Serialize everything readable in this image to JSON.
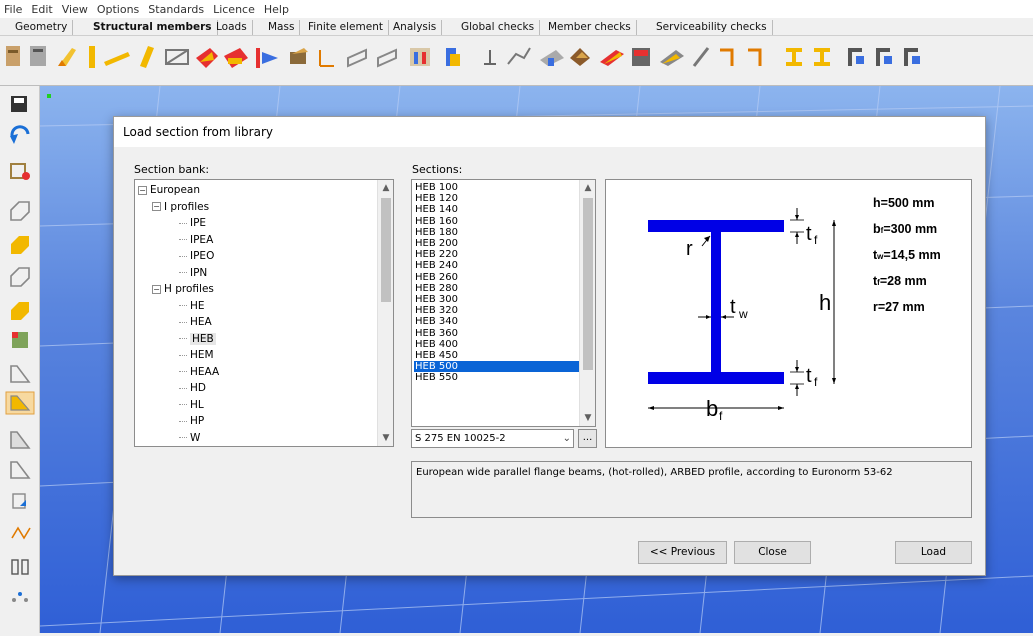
{
  "menu": [
    "File",
    "Edit",
    "View",
    "Options",
    "Standards",
    "Licence",
    "Help"
  ],
  "tabs": [
    {
      "label": "Geometry",
      "active": false
    },
    {
      "label": "Structural members",
      "active": true
    },
    {
      "label": "Loads",
      "active": false
    },
    {
      "label": "Mass",
      "active": false
    },
    {
      "label": "Finite element",
      "active": false
    },
    {
      "label": "Analysis",
      "active": false
    },
    {
      "label": "Global checks",
      "active": false
    },
    {
      "label": "Member checks",
      "active": false
    },
    {
      "label": "Serviceability checks",
      "active": false
    }
  ],
  "dialog": {
    "title": "Load section from library",
    "section_bank_label": "Section bank:",
    "sections_label": "Sections:",
    "tree": [
      {
        "label": "European",
        "level": 0,
        "expander": "−"
      },
      {
        "label": "I profiles",
        "level": 1,
        "expander": "−"
      },
      {
        "label": "IPE",
        "level": 2
      },
      {
        "label": "IPEA",
        "level": 2
      },
      {
        "label": "IPEO",
        "level": 2
      },
      {
        "label": "IPN",
        "level": 2
      },
      {
        "label": "H profiles",
        "level": 1,
        "expander": "−"
      },
      {
        "label": "HE",
        "level": 2
      },
      {
        "label": "HEA",
        "level": 2
      },
      {
        "label": "HEB",
        "level": 2,
        "selected": true
      },
      {
        "label": "HEM",
        "level": 2
      },
      {
        "label": "HEAA",
        "level": 2
      },
      {
        "label": "HD",
        "level": 2
      },
      {
        "label": "HL",
        "level": 2
      },
      {
        "label": "HP",
        "level": 2
      },
      {
        "label": "W",
        "level": 2
      }
    ],
    "sections": [
      "HEB 100",
      "HEB 120",
      "HEB 140",
      "HEB 160",
      "HEB 180",
      "HEB 200",
      "HEB 220",
      "HEB 240",
      "HEB 260",
      "HEB 280",
      "HEB 300",
      "HEB 320",
      "HEB 340",
      "HEB 360",
      "HEB 400",
      "HEB 450",
      "HEB 500",
      "HEB 550"
    ],
    "selected_section": "HEB 500",
    "material": "S 275 EN 10025-2",
    "dots_label": "...",
    "preview": {
      "r_label": "r",
      "h_label": "h",
      "b_label": "b",
      "b_sub": "f",
      "t_label": "t",
      "tf_sub": "f",
      "tw_sub": "w",
      "props": [
        {
          "name": "h",
          "sub": "",
          "value": "=500 mm"
        },
        {
          "name": "b",
          "sub": "f",
          "value": "=300 mm"
        },
        {
          "name": "t",
          "sub": "w",
          "value": "=14,5 mm"
        },
        {
          "name": "t",
          "sub": "f",
          "value": "=28 mm"
        },
        {
          "name": "r",
          "sub": "",
          "value": "=27 mm"
        }
      ],
      "accent": "#0000e6"
    },
    "description": "European wide parallel flange beams, (hot-rolled), ARBED profile, according to Euronorm 53-62",
    "buttons": {
      "previous": "<< Previous",
      "close": "Close",
      "load": "Load"
    }
  }
}
